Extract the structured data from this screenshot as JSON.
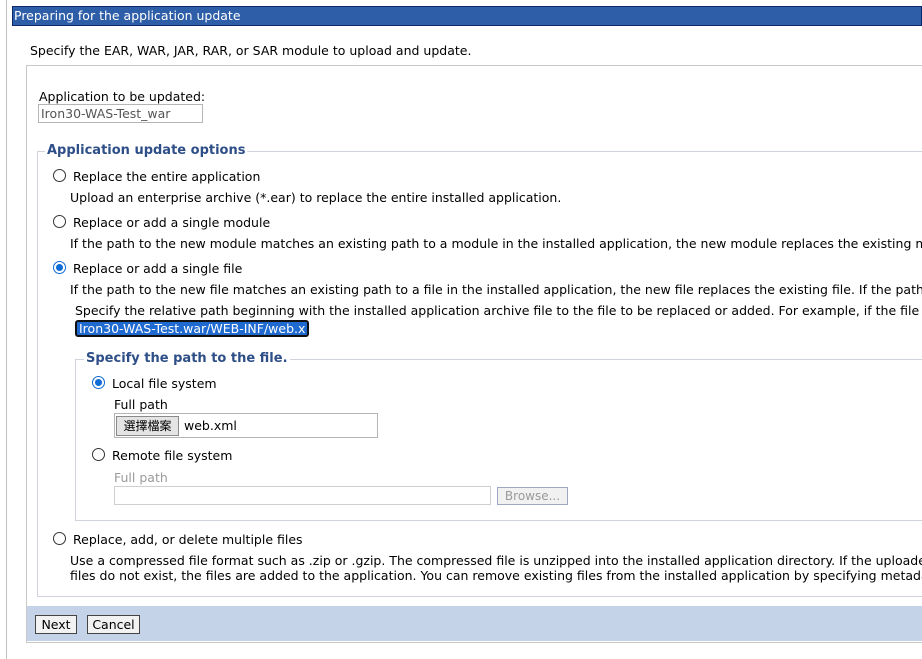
{
  "window": {
    "title": "Preparing for the application update"
  },
  "intro": "Specify the EAR, WAR, JAR, RAR, or SAR module to upload and update.",
  "app_to_update": {
    "label": "Application to be updated:",
    "value": "Iron30-WAS-Test_war"
  },
  "update_options": {
    "legend": "Application update options",
    "options": [
      {
        "label": "Replace the entire application",
        "description": "Upload an enterprise archive (*.ear) to replace the entire installed application.",
        "selected": false
      },
      {
        "label": "Replace or add a single module",
        "description": "If the path to the new module matches an existing path to a module in the installed application, the new module replaces the existing modul",
        "selected": false
      },
      {
        "label": "Replace or add a single file",
        "description": "If the path to the new file matches an existing path to a file in the installed application, the new file replaces the existing file. If the path to t",
        "hint": "Specify the relative path beginning with the installed application archive file to the file to be replaced or added. For example, if the file is loc",
        "path_value": "Iron30-WAS-Test.war/WEB-INF/web.x",
        "selected": true
      },
      {
        "label": "Replace, add, or delete multiple files",
        "description_line1": "Use a compressed file format such as .zip or .gzip. The compressed file is unzipped into the installed application directory. If the uploaded fil",
        "description_line2": "files do not exist, the files are added to the application. You can remove existing files from the installed application by specifying metadata in",
        "selected": false
      }
    ]
  },
  "file_path": {
    "legend": "Specify the path to the file.",
    "local": {
      "label": "Local file system",
      "selected": true,
      "field_label": "Full path",
      "choose_button": "選擇檔案",
      "chosen_file": "web.xml"
    },
    "remote": {
      "label": "Remote file system",
      "selected": false,
      "field_label": "Full path",
      "value": "",
      "browse_button": "Browse..."
    }
  },
  "buttons": {
    "next": "Next",
    "cancel": "Cancel"
  }
}
